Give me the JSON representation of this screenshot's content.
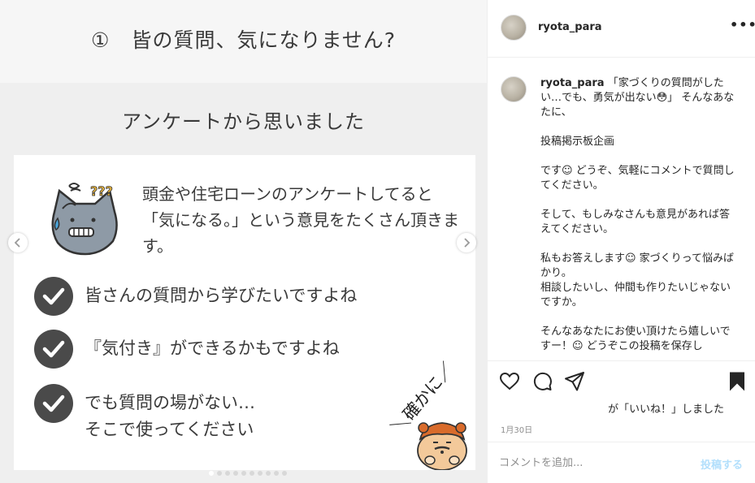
{
  "image": {
    "title": "①　皆の質問、気になりません?",
    "subtitle": "アンケートから思いました",
    "intro_text": "頭金や住宅ローンのアンケートしてると「気になる。」という意見をたくさん頂きます。",
    "checks": [
      {
        "line1": "皆さんの質問から学びたいですよね"
      },
      {
        "line1": "『気付き』ができるかもですよね"
      },
      {
        "line1": "でも質問の場がない…",
        "line2": "そこで使ってください"
      }
    ],
    "bubble_text": "＼確かに／",
    "carousel_dots": 10,
    "active_dot": 0
  },
  "header": {
    "username": "ryota_para",
    "more_icon": "more-options-icon"
  },
  "caption": {
    "username": "ryota_para",
    "text": " 「家づくりの質問がしたい…でも、勇気が出ない😳」 そんなあなたに、\n\n投稿掲示板企画\n\nです☺︎ どうぞ、気軽にコメントで質問してください。\n\nそして、もしみなさんも意見があれば答えてください。\n\n私もお答えします☺︎ 家づくりって悩みばかり。\n相談したいし、仲間も作りたいじゃないですか。\n\nそんなあなたにお使い頂けたら嬉しいですー！☺︎ どうぞこの投稿を保存し"
  },
  "actions": {
    "icons": [
      "heart-icon",
      "comment-icon",
      "share-icon",
      "bookmark-icon"
    ],
    "likes_text": "が「いいね！」しました",
    "date": "1月30日"
  },
  "add_comment": {
    "placeholder": "コメントを追加...",
    "post_label": "投稿する"
  },
  "colors": {
    "check_circle": "#4a4a4a",
    "post_button_disabled": "#b2dffc",
    "cat_body": "#8e9aa6"
  }
}
